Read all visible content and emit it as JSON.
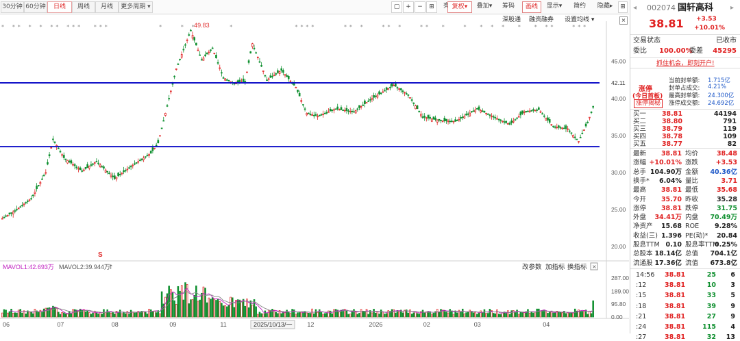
{
  "toolbar": {
    "tabs": [
      "30分钟",
      "60分钟",
      "日线",
      "周线",
      "月线",
      "更多周期 ▾"
    ],
    "right_buttons": [
      "亮点",
      "复权",
      "叠加",
      "筹码",
      "画线",
      "显示",
      "简约",
      "隐藏"
    ],
    "sub_buttons": [
      "深股通",
      "融资融券",
      "设置均线"
    ]
  },
  "chart_data": {
    "type": "candlestick",
    "y_ticks": [
      "45.00",
      "40.00",
      "35.00",
      "30.00",
      "25.00",
      "20.00"
    ],
    "y_range": [
      19,
      49.5
    ],
    "max_label": "49.83",
    "hline_label": "42.11",
    "hlines": [
      42.11,
      33.5
    ],
    "x_labels": [
      "06",
      "07",
      "08",
      "09",
      "11",
      "12",
      "2026",
      "02",
      "03",
      "04"
    ],
    "cursor_date": "2025/10/13/一",
    "vol_ticks": [
      "287.00",
      "189.00",
      "95.80",
      "0.00"
    ],
    "vol_axis_max": 287,
    "mavol1": "MAVOL1:42.693万",
    "mavol2": "MAVOL2:39.944万",
    "vol_buttons": [
      "改参数",
      "加指标",
      "换指标"
    ],
    "marker_s": "S",
    "anchors": [
      [
        0,
        23.8
      ],
      [
        8,
        25
      ],
      [
        16,
        26.5
      ],
      [
        24,
        30
      ],
      [
        28,
        34.5
      ],
      [
        34,
        32
      ],
      [
        44,
        30.2
      ],
      [
        52,
        31.5
      ],
      [
        62,
        29.2
      ],
      [
        72,
        31
      ],
      [
        82,
        32.6
      ],
      [
        86,
        34
      ],
      [
        92,
        40
      ],
      [
        96,
        44
      ],
      [
        104,
        49.2
      ],
      [
        110,
        45.2
      ],
      [
        116,
        46.8
      ],
      [
        122,
        42.8
      ],
      [
        128,
        42
      ],
      [
        134,
        42.3
      ],
      [
        138,
        47.4
      ],
      [
        146,
        42.5
      ],
      [
        154,
        43.8
      ],
      [
        162,
        41.5
      ],
      [
        168,
        38
      ],
      [
        174,
        37.6
      ],
      [
        184,
        38.6
      ],
      [
        194,
        38.2
      ],
      [
        204,
        40
      ],
      [
        216,
        41.8
      ],
      [
        224,
        40.5
      ],
      [
        232,
        37.5
      ],
      [
        242,
        37
      ],
      [
        250,
        36.9
      ],
      [
        262,
        38.6
      ],
      [
        272,
        37.4
      ],
      [
        280,
        36.5
      ],
      [
        288,
        38.2
      ],
      [
        296,
        38.5
      ],
      [
        304,
        36.2
      ],
      [
        312,
        35.9
      ],
      [
        318,
        34.2
      ],
      [
        323,
        36.8
      ],
      [
        326,
        38.81
      ]
    ]
  },
  "quote": {
    "code": "002074",
    "name": "国轩高科",
    "price": "38.81",
    "change": "+3.53",
    "pct": "+10.01%",
    "status_label": "交易状态",
    "status_value": "已收市",
    "weibi_label": "委比",
    "weibi_value": "100.00%",
    "weicha_label": "委差",
    "weicha_value": "45295",
    "promo": "抓住机会，即刻开户!",
    "zt_title": "涨停",
    "zt_first": "(今日首板)",
    "zt_reveal": "涨停揭秘",
    "seal_rows": [
      {
        "label": "当前封单额:",
        "value": "1.715亿"
      },
      {
        "label": "封单占成交:",
        "value": "4.21%"
      },
      {
        "label": "最高封单额:",
        "value": "24.300亿"
      },
      {
        "label": "涨停成交额:",
        "value": "24.692亿"
      }
    ],
    "book": [
      {
        "label": "买一",
        "price": "38.81",
        "vol": "44194"
      },
      {
        "label": "买二",
        "price": "38.80",
        "vol": "791"
      },
      {
        "label": "买三",
        "price": "38.79",
        "vol": "119"
      },
      {
        "label": "买四",
        "price": "38.78",
        "vol": "109"
      },
      {
        "label": "买五",
        "price": "38.77",
        "vol": "82"
      }
    ],
    "stats": [
      {
        "l1": "最新",
        "v1": "38.81",
        "c1": "red",
        "l2": "均价",
        "v2": "38.48",
        "c2": "red"
      },
      {
        "l1": "涨幅",
        "v1": "+10.01%",
        "c1": "red",
        "l2": "涨跌",
        "v2": "+3.53",
        "c2": "red"
      },
      {
        "l1": "总手",
        "v1": "104.90万",
        "c1": "",
        "l2": "金额",
        "v2": "40.36亿",
        "c2": "blu"
      },
      {
        "l1": "换手*",
        "v1": "6.04%",
        "c1": "",
        "l2": "量比",
        "v2": "3.71",
        "c2": "red"
      },
      {
        "l1": "最高",
        "v1": "38.81",
        "c1": "red",
        "l2": "最低",
        "v2": "35.68",
        "c2": "red"
      },
      {
        "l1": "今开",
        "v1": "35.70",
        "c1": "red",
        "l2": "昨收",
        "v2": "35.28",
        "c2": ""
      },
      {
        "l1": "涨停",
        "v1": "38.81",
        "c1": "red",
        "l2": "跌停",
        "v2": "31.75",
        "c2": "grn"
      },
      {
        "l1": "外盘",
        "v1": "34.41万",
        "c1": "red",
        "l2": "内盘",
        "v2": "70.49万",
        "c2": "grn"
      },
      {
        "l1": "净资产",
        "v1": "15.68",
        "c1": "",
        "l2": "ROE",
        "v2": "9.28%",
        "c2": ""
      },
      {
        "l1": "收益(三)",
        "v1": "1.396",
        "c1": "",
        "l2": "PE(动)*",
        "v2": "20.84",
        "c2": ""
      },
      {
        "l1": "股息TTM",
        "v1": "0.10",
        "c1": "",
        "l2": "股息率TTM",
        "v2": "0.25%",
        "c2": ""
      },
      {
        "l1": "总股本",
        "v1": "18.14亿",
        "c1": "",
        "l2": "总值",
        "v2": "704.1亿",
        "c2": ""
      },
      {
        "l1": "流通股",
        "v1": "17.36亿",
        "c1": "",
        "l2": "流值",
        "v2": "673.8亿",
        "c2": ""
      }
    ],
    "ticks": [
      {
        "t": "14:56",
        "p": "38.81",
        "v": "25",
        "n": "6"
      },
      {
        "t": ":12",
        "p": "38.81",
        "v": "10",
        "n": "3"
      },
      {
        "t": ":15",
        "p": "38.81",
        "v": "33",
        "n": "5"
      },
      {
        "t": ":18",
        "p": "38.81",
        "v": "39",
        "n": "9"
      },
      {
        "t": ":21",
        "p": "38.81",
        "v": "27",
        "n": "9"
      },
      {
        "t": ":24",
        "p": "38.81",
        "v": "115",
        "n": "4"
      },
      {
        "t": ":27",
        "p": "38.81",
        "v": "32",
        "n": "13"
      }
    ]
  }
}
